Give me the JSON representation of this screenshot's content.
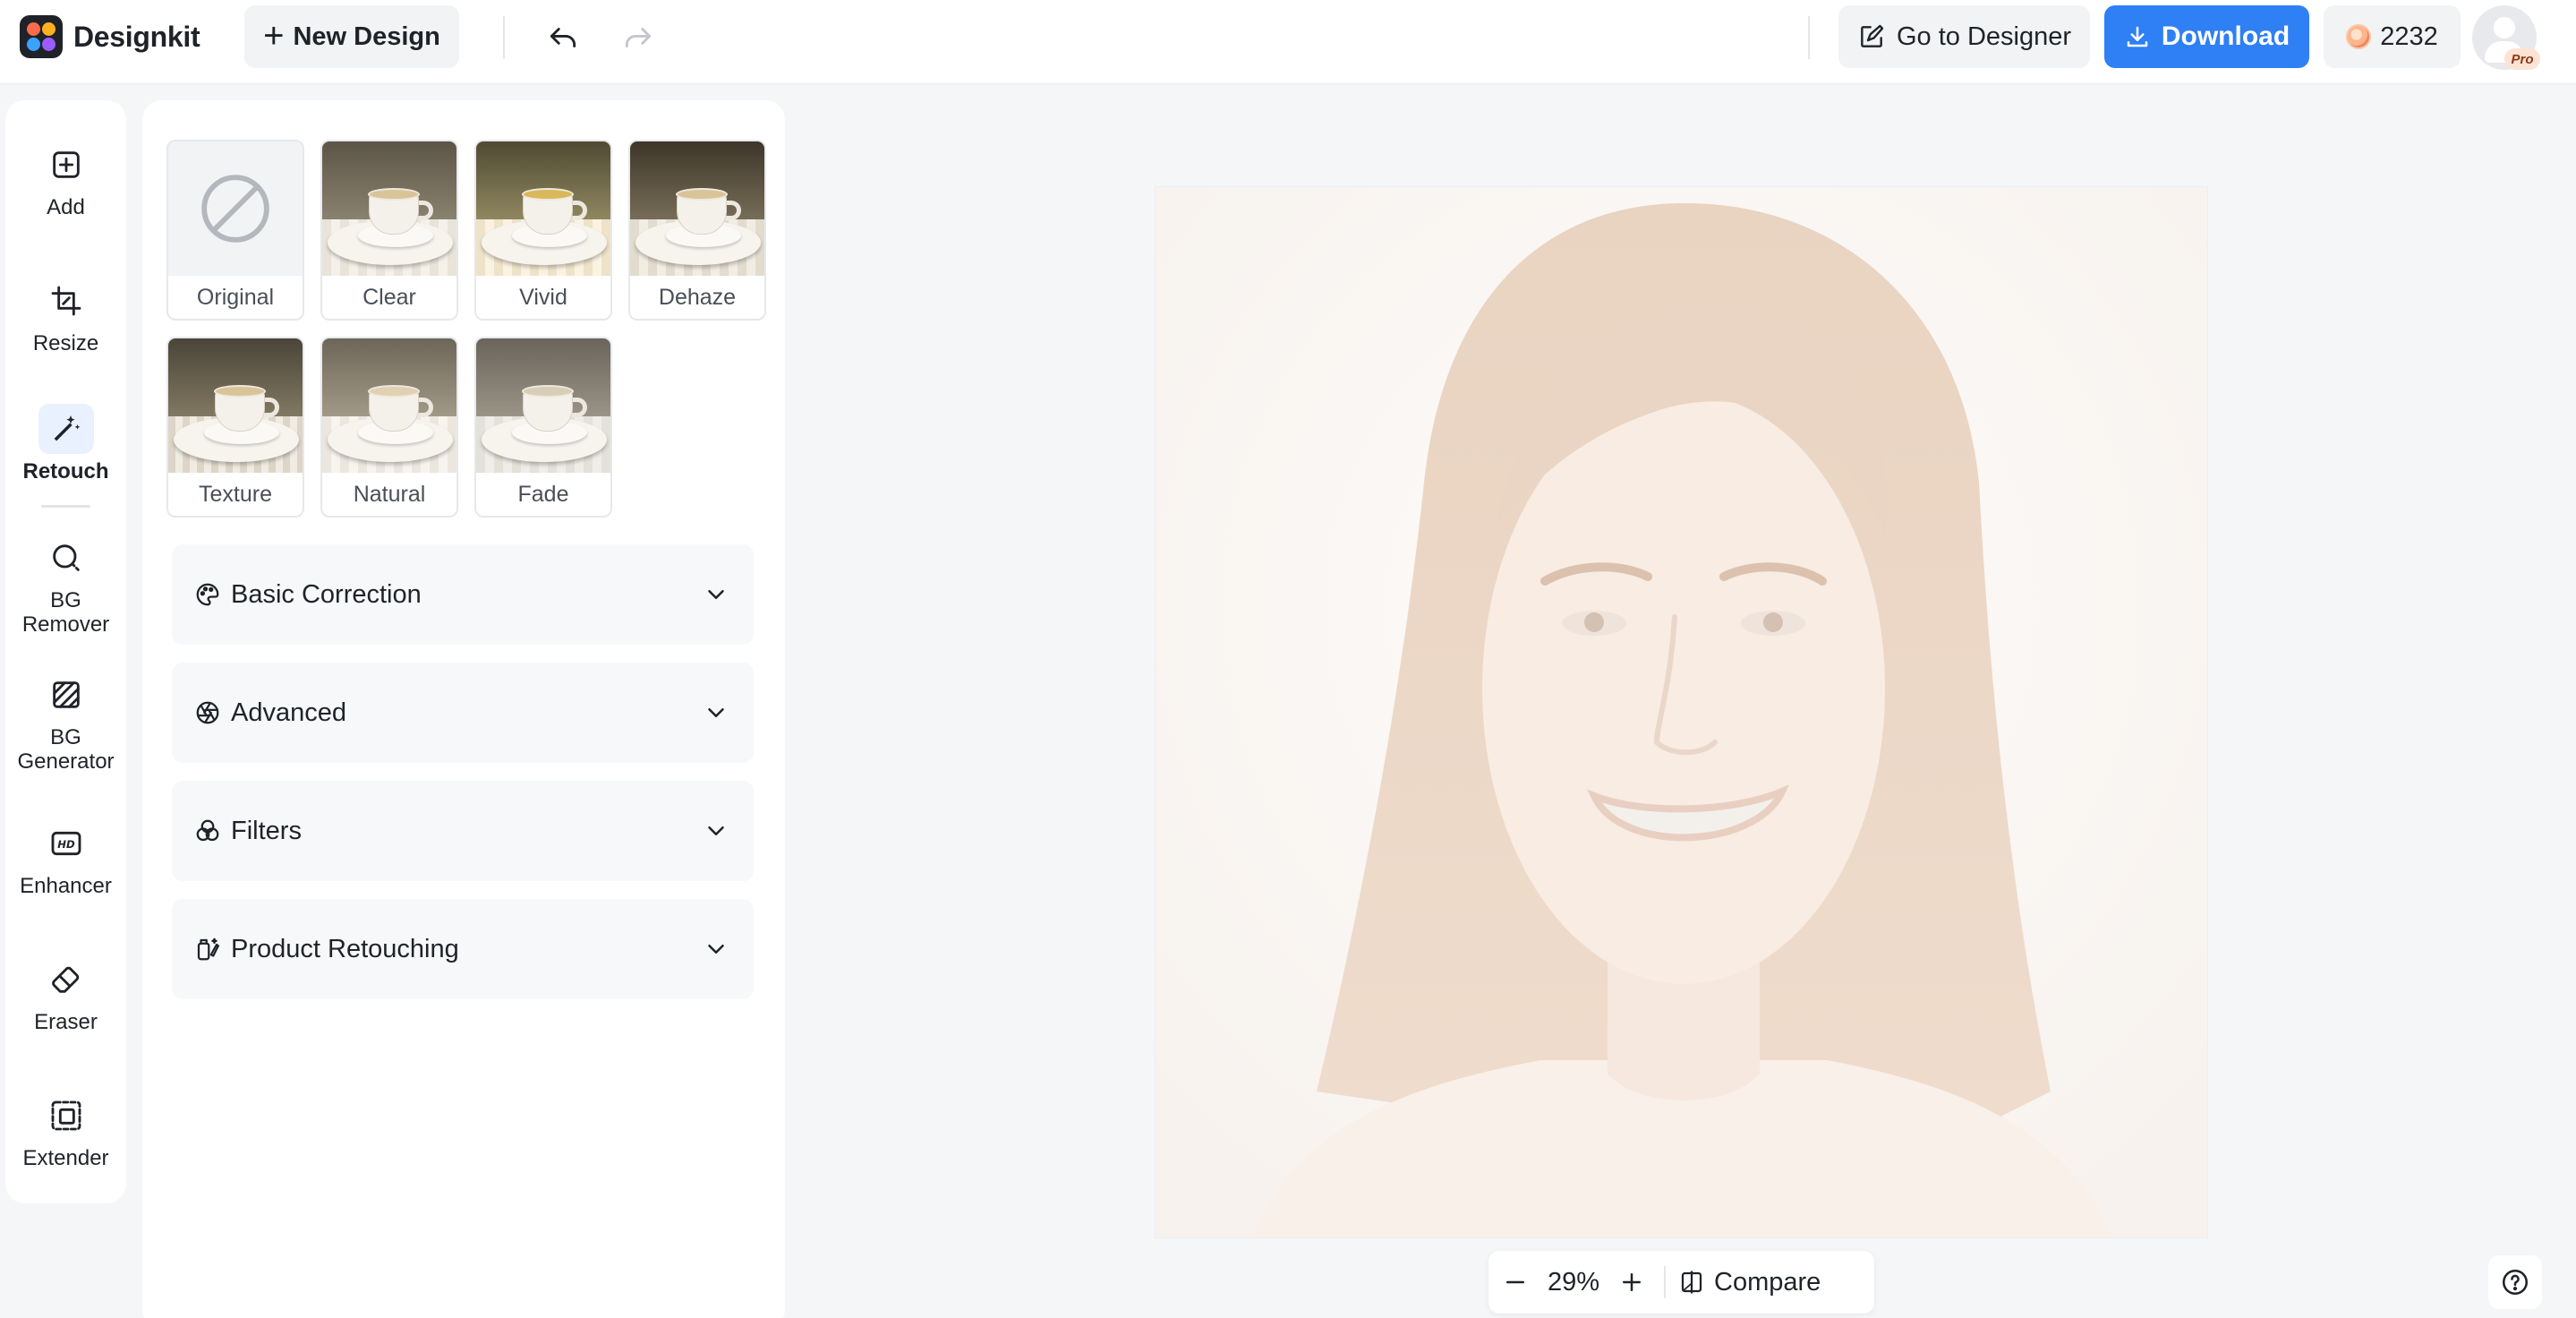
{
  "app": {
    "name": "Designkit"
  },
  "toolbar": {
    "new_design": "New Design",
    "go_to_designer": "Go to Designer",
    "download": "Download",
    "credits": "2232",
    "pro_badge": "Pro",
    "icons": {
      "undo": "undo-icon",
      "redo": "redo-icon"
    }
  },
  "tools": [
    {
      "label": "Add",
      "icon": "add-icon"
    },
    {
      "label": "Resize",
      "icon": "resize-icon"
    },
    {
      "label": "Retouch",
      "icon": "magic-wand-icon",
      "active": true
    },
    {
      "label": "BG Remover",
      "icon": "bg-remover-icon"
    },
    {
      "label": "BG Generator",
      "icon": "bg-generator-icon"
    },
    {
      "label": "Enhancer",
      "icon": "hd-icon"
    },
    {
      "label": "Eraser",
      "icon": "eraser-icon"
    },
    {
      "label": "Extender",
      "icon": "extender-icon"
    }
  ],
  "presets": [
    {
      "name": "Original"
    },
    {
      "name": "Clear"
    },
    {
      "name": "Vivid"
    },
    {
      "name": "Dehaze"
    },
    {
      "name": "Texture"
    },
    {
      "name": "Natural"
    },
    {
      "name": "Fade"
    }
  ],
  "sections": [
    {
      "label": "Basic Correction",
      "icon": "palette-icon"
    },
    {
      "label": "Advanced",
      "icon": "aperture-icon"
    },
    {
      "label": "Filters",
      "icon": "filters-icon"
    },
    {
      "label": "Product Retouching",
      "icon": "product-retouch-icon"
    }
  ],
  "zoom": {
    "level": "29%",
    "compare": "Compare"
  },
  "colors": {
    "accent": "#2f7ff5",
    "active_tool_bg": "#e9f1ff"
  }
}
